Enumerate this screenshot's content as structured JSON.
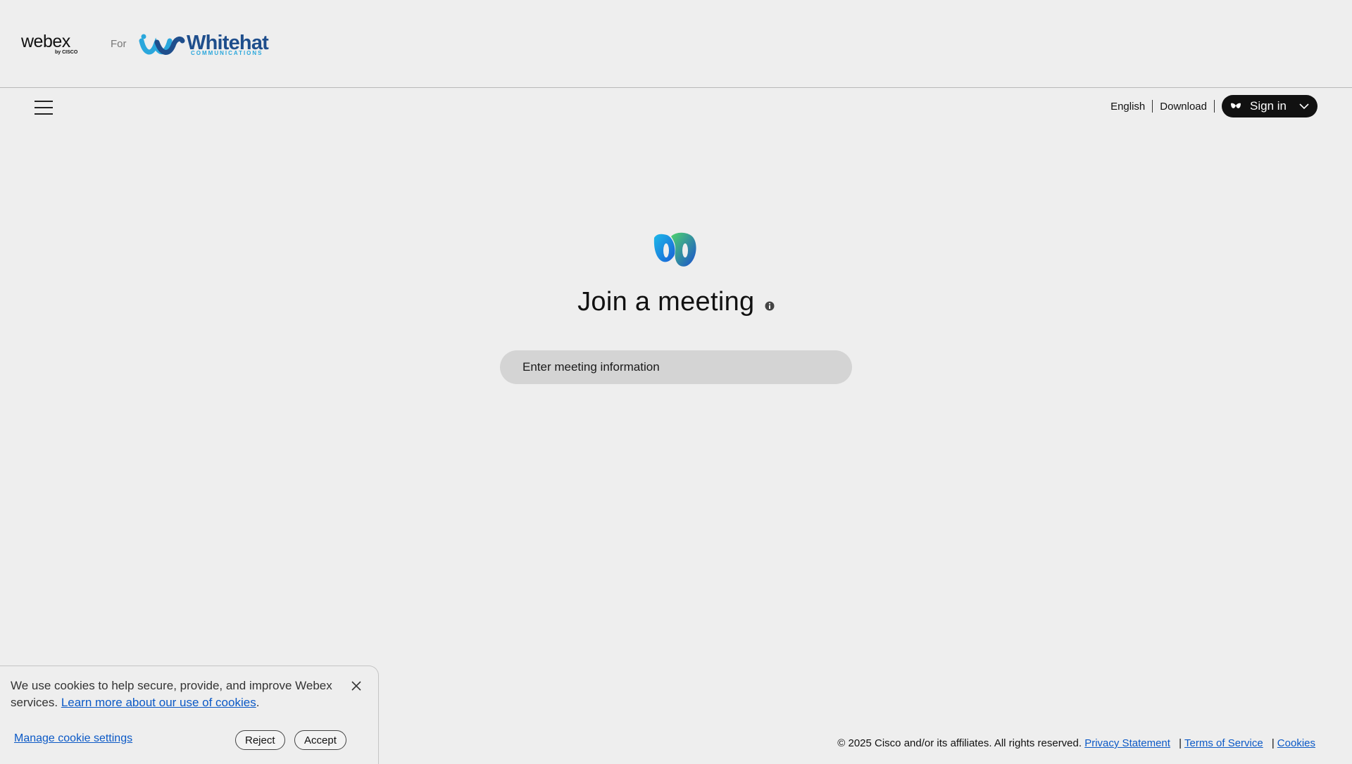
{
  "header": {
    "product_name": "webex",
    "product_byline": "by CISCO",
    "for_label": "For",
    "company_name": "Whitehat",
    "company_tagline": "COMMUNICATIONS"
  },
  "nav": {
    "language": "English",
    "download": "Download",
    "signin": "Sign in"
  },
  "main": {
    "title": "Join a meeting",
    "input_placeholder": "Enter meeting information",
    "input_value": ""
  },
  "cookie_banner": {
    "text": "We use cookies to help secure, provide, and improve Webex services.",
    "link": "Learn more about our use of cookies",
    "trailing": ".",
    "manage": "Manage cookie settings",
    "reject": "Reject",
    "accept": "Accept"
  },
  "footer": {
    "copyright": "© 2025 Cisco and/or its affiliates. All rights reserved.",
    "privacy": "Privacy Statement",
    "terms": "Terms of Service",
    "cookies": "Cookies",
    "separator": "|"
  },
  "icons": {
    "menu": "hamburger-menu-icon",
    "signin": "webex-icon",
    "dropdown": "chevron-down-icon",
    "info": "info-icon",
    "close": "close-icon"
  },
  "colors": {
    "background": "#eeeeee",
    "link": "#0b59c6",
    "signin_bg": "#111111",
    "input_bg": "#d4d4d4",
    "brand_navy": "#1f4e8c",
    "brand_cyan": "#2aa7dc"
  }
}
